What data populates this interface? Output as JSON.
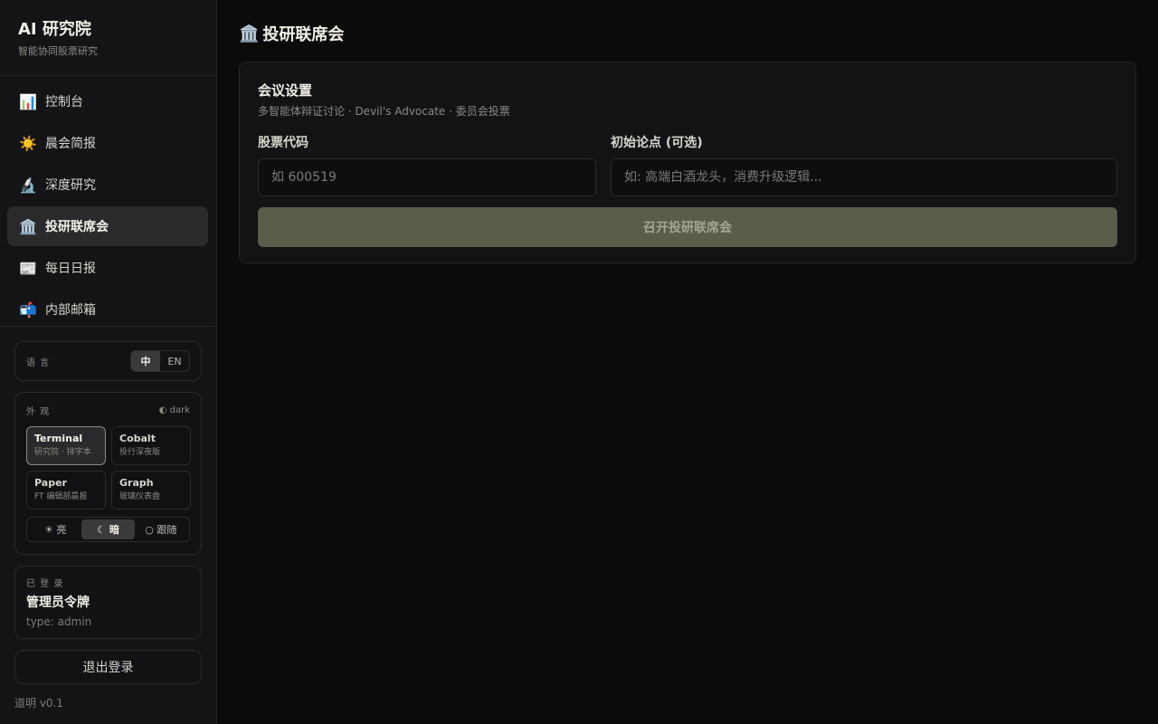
{
  "brand": {
    "title": "AI 研究院",
    "subtitle": "智能协同股票研究"
  },
  "nav": {
    "items": [
      {
        "icon": "📊",
        "label": "控制台"
      },
      {
        "icon": "☀️",
        "label": "晨会简报"
      },
      {
        "icon": "🔬",
        "label": "深度研究"
      },
      {
        "icon": "🏛️",
        "label": "投研联席会"
      },
      {
        "icon": "📰",
        "label": "每日日报"
      },
      {
        "icon": "📬",
        "label": "内部邮箱"
      }
    ],
    "active_index": 3
  },
  "language": {
    "label": "语 言",
    "options": [
      "中",
      "EN"
    ],
    "selected": "中"
  },
  "appearance": {
    "label": "外 观",
    "mode_tag": "◐ dark",
    "themes": [
      {
        "name": "Terminal",
        "desc": "研究院 · 排字本"
      },
      {
        "name": "Cobalt",
        "desc": "投行深夜版"
      },
      {
        "name": "Paper",
        "desc": "FT 编辑部晨报"
      },
      {
        "name": "Graph",
        "desc": "玻璃仪表盘"
      }
    ],
    "selected_theme": "Terminal",
    "modes": [
      "☀ 亮",
      "☾ 暗",
      "○ 跟随"
    ],
    "selected_mode": "☾ 暗"
  },
  "user": {
    "status": "已 登 录",
    "name": "管理员令牌",
    "type": "type: admin"
  },
  "logout_label": "退出登录",
  "version": "道明 v0.1",
  "page": {
    "icon": "🏛️",
    "title": "投研联席会",
    "panel": {
      "title": "会议设置",
      "subtitle": "多智能体辩证讨论 · Devil's Advocate · 委员会投票",
      "stock_label": "股票代码",
      "stock_placeholder": "如 600519",
      "thesis_label": "初始论点 (可选)",
      "thesis_placeholder": "如: 高端白酒龙头，消费升级逻辑...",
      "submit_label": "召开投研联席会"
    }
  },
  "colors": {
    "background": "#0b0b0c",
    "sidebar": "#141416",
    "accent_button": "#5b5c49"
  }
}
